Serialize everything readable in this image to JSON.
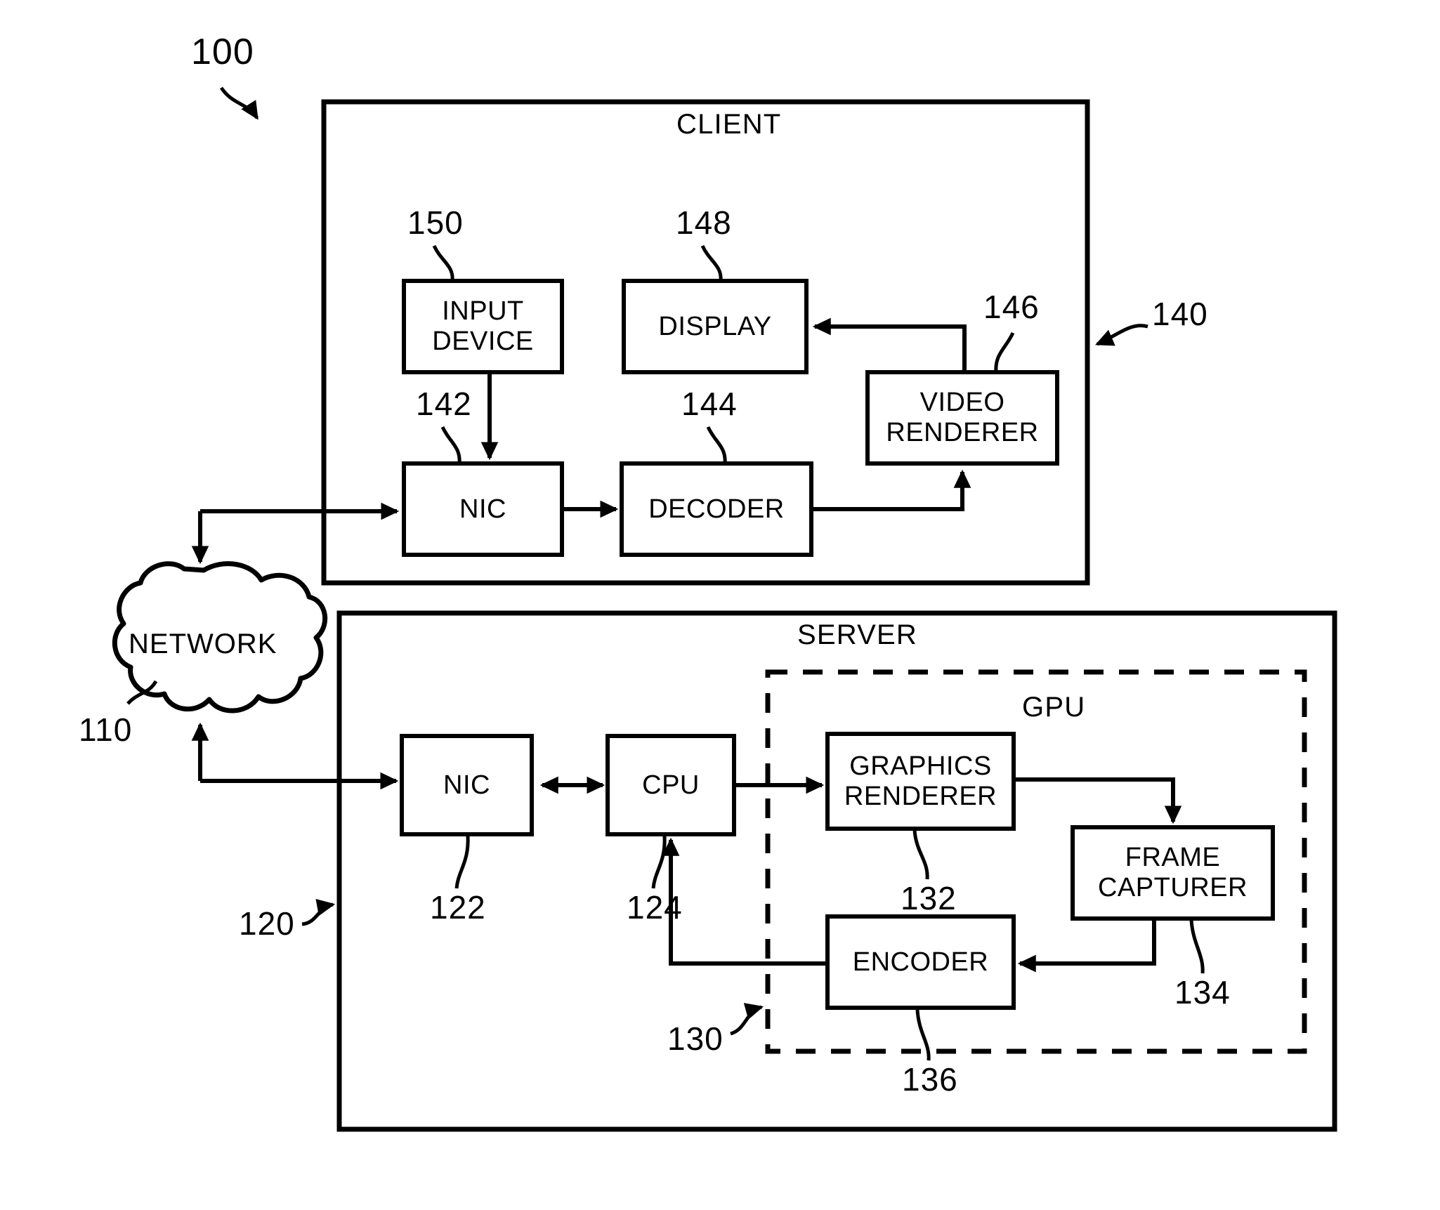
{
  "figure": {
    "reference_numeral": "100",
    "containers": [
      {
        "id": "client",
        "label": "CLIENT",
        "ref": "140",
        "style": "solid"
      },
      {
        "id": "server",
        "label": "SERVER",
        "ref": "120",
        "style": "solid"
      },
      {
        "id": "gpu",
        "label": "GPU",
        "ref": "130",
        "style": "dashed"
      }
    ],
    "cloud": {
      "label": "NETWORK",
      "ref": "110"
    },
    "blocks": [
      {
        "id": "input-device",
        "label": "INPUT\nDEVICE",
        "ref": "150",
        "parent": "client"
      },
      {
        "id": "display",
        "label": "DISPLAY",
        "ref": "148",
        "parent": "client"
      },
      {
        "id": "video-renderer",
        "label": "VIDEO\nRENDERER",
        "ref": "146",
        "parent": "client"
      },
      {
        "id": "client-nic",
        "label": "NIC",
        "ref": "142",
        "parent": "client"
      },
      {
        "id": "decoder",
        "label": "DECODER",
        "ref": "144",
        "parent": "client"
      },
      {
        "id": "server-nic",
        "label": "NIC",
        "ref": "122",
        "parent": "server"
      },
      {
        "id": "cpu",
        "label": "CPU",
        "ref": "124",
        "parent": "server"
      },
      {
        "id": "graphics-renderer",
        "label": "GRAPHICS\nRENDERER",
        "ref": "132",
        "parent": "gpu"
      },
      {
        "id": "frame-capturer",
        "label": "FRAME\nCAPTURER",
        "ref": "134",
        "parent": "gpu"
      },
      {
        "id": "encoder",
        "label": "ENCODER",
        "ref": "136",
        "parent": "gpu"
      }
    ],
    "connections": [
      {
        "from": "network",
        "to": "client-nic",
        "type": "arrow"
      },
      {
        "from": "input-device",
        "to": "client-nic",
        "type": "arrow"
      },
      {
        "from": "client-nic",
        "to": "decoder",
        "type": "arrow"
      },
      {
        "from": "decoder",
        "to": "video-renderer",
        "type": "arrow"
      },
      {
        "from": "video-renderer",
        "to": "display",
        "type": "arrow"
      },
      {
        "from": "server-nic",
        "to": "network",
        "type": "arrow"
      },
      {
        "from": "network",
        "to": "server-nic",
        "type": "arrow"
      },
      {
        "from": "server-nic",
        "to": "cpu",
        "type": "double-arrow"
      },
      {
        "from": "cpu",
        "to": "graphics-renderer",
        "type": "arrow"
      },
      {
        "from": "graphics-renderer",
        "to": "frame-capturer",
        "type": "arrow"
      },
      {
        "from": "frame-capturer",
        "to": "encoder",
        "type": "arrow"
      },
      {
        "from": "encoder",
        "to": "cpu",
        "type": "arrow"
      }
    ],
    "colors": {
      "ink": "#000000",
      "background": "#ffffff"
    }
  }
}
